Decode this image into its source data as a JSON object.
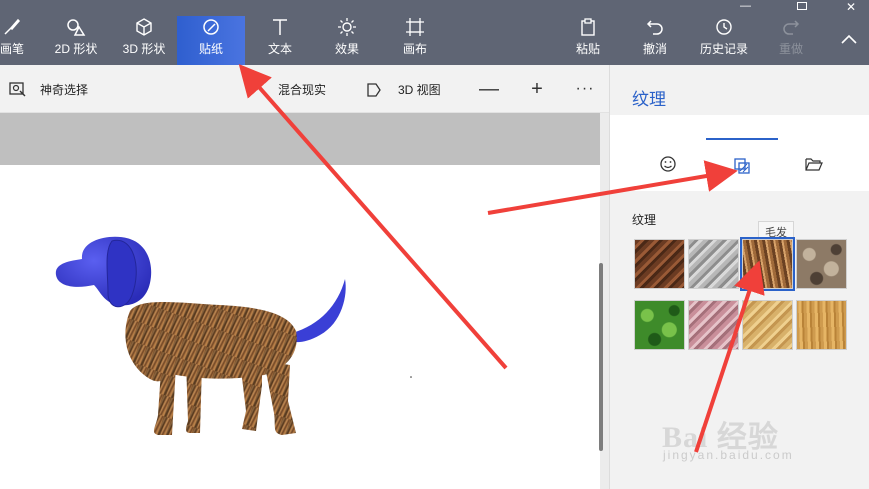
{
  "ribbon": {
    "tools": [
      {
        "key": "brush",
        "label": "画笔",
        "icon": "brush-icon"
      },
      {
        "key": "shapes2d",
        "label": "2D 形状",
        "icon": "shapes-2d-icon"
      },
      {
        "key": "shapes3d",
        "label": "3D 形状",
        "icon": "cube-icon"
      },
      {
        "key": "stickers",
        "label": "贴纸",
        "icon": "sticker-icon",
        "active": true
      },
      {
        "key": "text",
        "label": "文本",
        "icon": "text-icon"
      },
      {
        "key": "effects",
        "label": "效果",
        "icon": "sun-icon"
      },
      {
        "key": "canvas",
        "label": "画布",
        "icon": "canvas-icon"
      },
      {
        "key": "paste",
        "label": "粘贴",
        "icon": "clipboard-icon"
      },
      {
        "key": "undo",
        "label": "撤消",
        "icon": "undo-icon"
      },
      {
        "key": "history",
        "label": "历史记录",
        "icon": "history-icon"
      },
      {
        "key": "redo",
        "label": "重做",
        "icon": "redo-icon",
        "disabled": true
      }
    ]
  },
  "subbar": {
    "magic_select": "神奇选择",
    "mixed_reality": "混合现实",
    "view_3d": "3D 视图",
    "zoom_out": "—",
    "zoom_in": "+",
    "more": "···"
  },
  "panel": {
    "title": "纹理",
    "tabs": [
      {
        "key": "stickers",
        "icon": "smiley-icon"
      },
      {
        "key": "textures",
        "icon": "texture-icon",
        "active": true
      },
      {
        "key": "custom",
        "icon": "folder-open-icon"
      }
    ],
    "section_label": "纹理",
    "hover_tip": "毛发",
    "textures": [
      {
        "name": "bark",
        "colors": [
          "#6b3b22",
          "#9a5a36",
          "#4a2816"
        ]
      },
      {
        "name": "stone",
        "colors": [
          "#b7b7b7",
          "#8d8d8d",
          "#d9d9d9"
        ]
      },
      {
        "name": "fur",
        "colors": [
          "#a06a3a",
          "#6b4122",
          "#d7a26a"
        ],
        "selected": true
      },
      {
        "name": "pebbles",
        "colors": [
          "#8d7a66",
          "#c2b29c",
          "#4e4035"
        ]
      },
      {
        "name": "leaves",
        "colors": [
          "#3e8b2a",
          "#79c24a",
          "#1f5a18"
        ]
      },
      {
        "name": "marble",
        "colors": [
          "#c98f9a",
          "#e6c3c9",
          "#a5707a"
        ]
      },
      {
        "name": "sand",
        "colors": [
          "#d8b16a",
          "#efd08f",
          "#c49650"
        ]
      },
      {
        "name": "wood",
        "colors": [
          "#cf9b4e",
          "#e6b565",
          "#b98338"
        ]
      }
    ]
  },
  "watermark": {
    "brand": "Bai 经验",
    "url": "jingyan.baidu.com"
  },
  "colors": {
    "ribbon_bg": "#5f6574",
    "accent": "#2b62c9",
    "arrow": "#f0403a",
    "dog_head": "#3a3fd6"
  }
}
